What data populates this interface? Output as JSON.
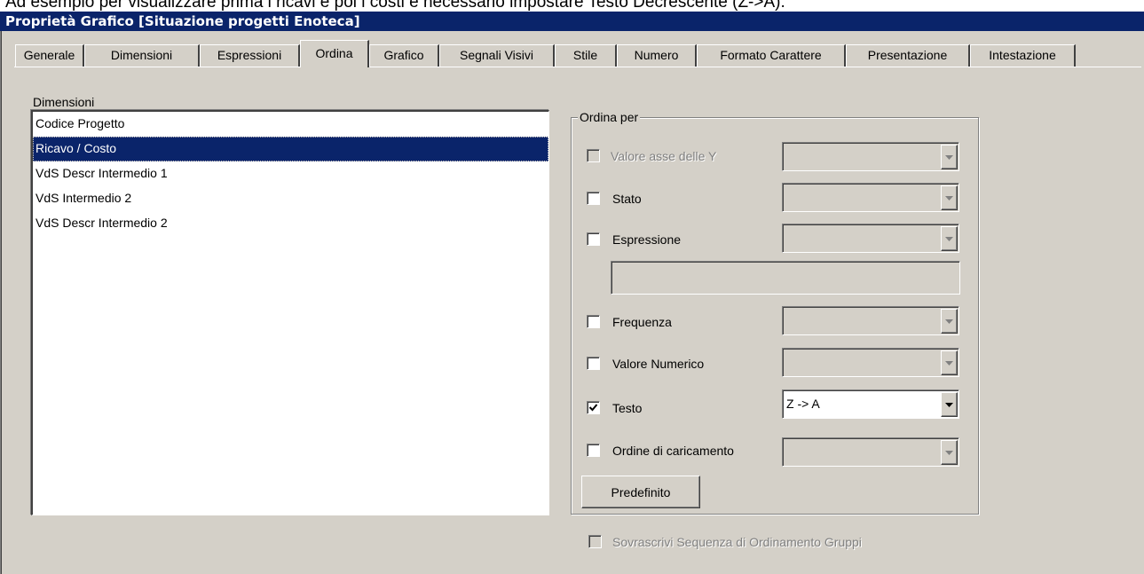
{
  "doc_text": "Ad esempio per visualizzare prima i ricavi e poi i costi è necessario impostare Testo Decrescente (Z->A).",
  "window": {
    "title": "Proprietà Grafico [Situazione progetti Enoteca]"
  },
  "tabs": [
    {
      "label": "Generale",
      "active": false
    },
    {
      "label": "Dimensioni",
      "active": false
    },
    {
      "label": "Espressioni",
      "active": false
    },
    {
      "label": "Ordina",
      "active": true
    },
    {
      "label": "Grafico",
      "active": false
    },
    {
      "label": "Segnali Visivi",
      "active": false
    },
    {
      "label": "Stile",
      "active": false
    },
    {
      "label": "Numero",
      "active": false
    },
    {
      "label": "Formato Carattere",
      "active": false
    },
    {
      "label": "Presentazione",
      "active": false
    },
    {
      "label": "Intestazione",
      "active": false
    }
  ],
  "dimensions": {
    "label": "Dimensioni",
    "items": [
      {
        "label": "Codice Progetto",
        "selected": false
      },
      {
        "label": "Ricavo / Costo",
        "selected": true
      },
      {
        "label": "VdS Descr Intermedio 1",
        "selected": false
      },
      {
        "label": "VdS Intermedio 2",
        "selected": false
      },
      {
        "label": "VdS Descr Intermedio 2",
        "selected": false
      }
    ]
  },
  "sort_by": {
    "title": "Ordina per",
    "options": [
      {
        "label": "Valore asse delle Y",
        "checked": false,
        "enabled": false,
        "combo_value": ""
      },
      {
        "label": "Stato",
        "checked": false,
        "enabled": true,
        "combo_value": ""
      },
      {
        "label": "Espressione",
        "checked": false,
        "enabled": true,
        "combo_value": ""
      },
      {
        "label": "Frequenza",
        "checked": false,
        "enabled": true,
        "combo_value": ""
      },
      {
        "label": "Valore Numerico",
        "checked": false,
        "enabled": true,
        "combo_value": ""
      },
      {
        "label": "Testo",
        "checked": true,
        "enabled": true,
        "combo_value": "Z -> A"
      },
      {
        "label": "Ordine di caricamento",
        "checked": false,
        "enabled": true,
        "combo_value": ""
      }
    ],
    "expression_value": "",
    "default_button": "Predefinito"
  },
  "override": {
    "label": "Sovrascrivi Sequenza di Ordinamento Gruppi",
    "checked": false,
    "enabled": false
  },
  "icons": {
    "check": "check-icon",
    "dropdown": "dropdown-arrow-icon"
  }
}
